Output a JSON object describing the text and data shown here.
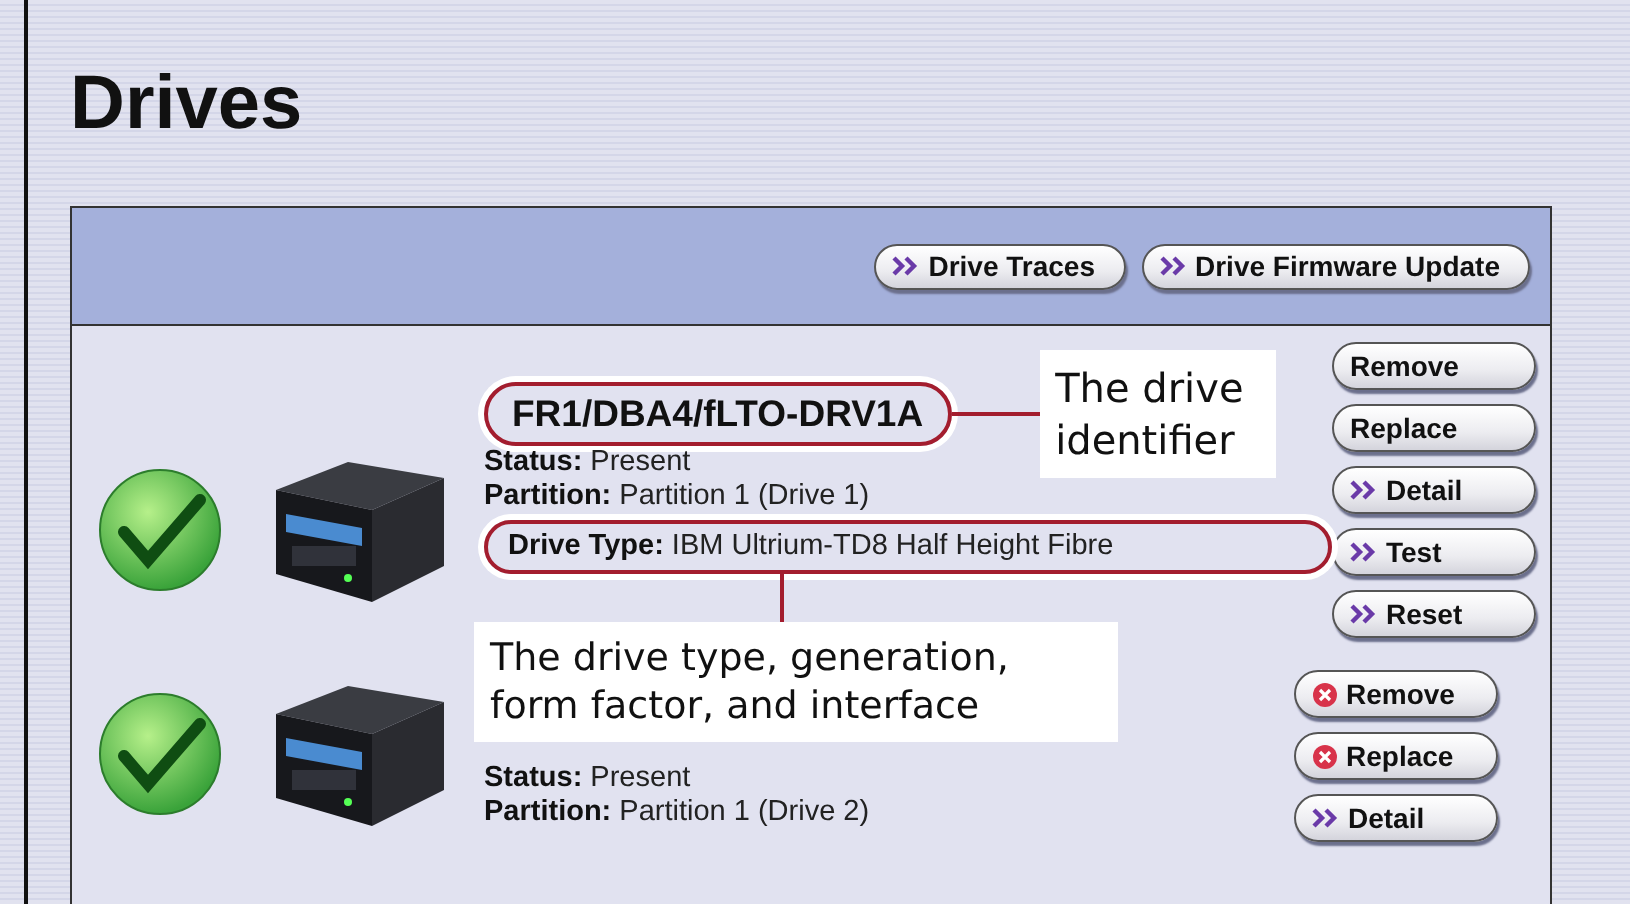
{
  "page": {
    "title": "Drives"
  },
  "toolbar": {
    "buttons": [
      {
        "label": "Drive Traces",
        "kind": "action"
      },
      {
        "label": "Drive Firmware Update",
        "kind": "action"
      }
    ]
  },
  "drives": [
    {
      "name": "FR1/DBA4/fLTO-DRV1A",
      "ok": true,
      "status_label": "Status:",
      "status": "Present",
      "partition_label": "Partition:",
      "partition": "Partition 1 (Drive 1)",
      "type_label": "Drive Type:",
      "type": "IBM Ultrium-TD8 Half Height Fibre",
      "buttons": [
        {
          "label": "Remove",
          "kind": "plain"
        },
        {
          "label": "Replace",
          "kind": "plain"
        },
        {
          "label": "Detail",
          "kind": "action"
        },
        {
          "label": "Test",
          "kind": "action"
        },
        {
          "label": "Reset",
          "kind": "action"
        }
      ]
    },
    {
      "ok": true,
      "status_label": "Status:",
      "status": "Present",
      "partition_label": "Partition:",
      "partition": "Partition 1 (Drive 2)",
      "buttons": [
        {
          "label": "Remove",
          "kind": "danger"
        },
        {
          "label": "Replace",
          "kind": "danger"
        },
        {
          "label": "Detail",
          "kind": "action"
        }
      ]
    }
  ],
  "callouts": [
    {
      "text": "The drive identifier"
    },
    {
      "text": "The drive type, generation, form factor, and interface"
    }
  ]
}
